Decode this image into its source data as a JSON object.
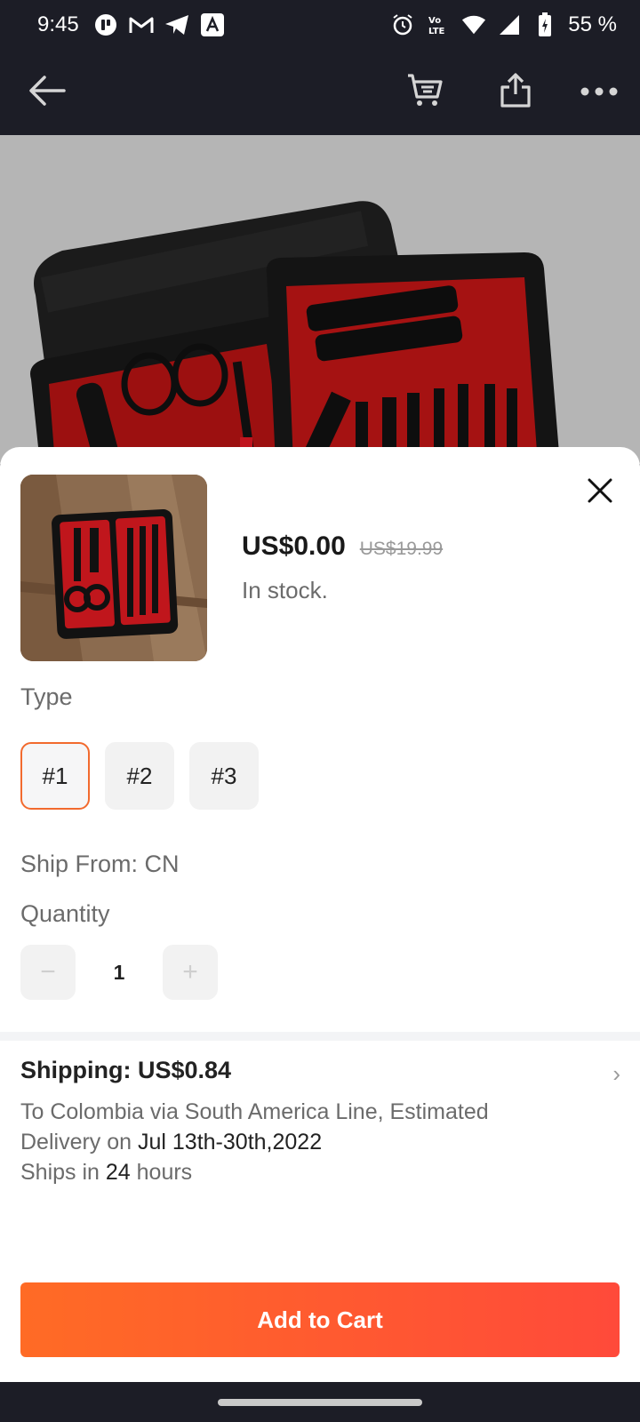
{
  "status_bar": {
    "time": "9:45",
    "battery": "55 %",
    "icons_left": [
      "app-icon",
      "gmail-icon",
      "telegram-icon",
      "app-store-icon"
    ],
    "icons_right": [
      "alarm-icon",
      "volte-icon",
      "wifi-icon",
      "signal-icon",
      "battery-icon"
    ]
  },
  "app_bar": {
    "icons": [
      "back-arrow-icon",
      "cart-icon",
      "share-icon",
      "more-icon"
    ]
  },
  "product": {
    "price": "US$0.00",
    "original_price": "US$19.99",
    "stock": "In stock."
  },
  "type": {
    "label": "Type",
    "options": [
      "#1",
      "#2",
      "#3"
    ],
    "selected": "#1"
  },
  "ship_from": "Ship From: CN",
  "quantity": {
    "label": "Quantity",
    "value": "1",
    "minus": "−",
    "plus": "+"
  },
  "shipping": {
    "title": "Shipping: US$0.84",
    "line1": "To Colombia via South America Line, Estimated",
    "line2_prefix": "Delivery on ",
    "delivery_dates": "Jul 13th-30th,2022",
    "line3_prefix": "Ships in ",
    "ship_hours": "24",
    "line3_suffix": " hours",
    "chevron": "›"
  },
  "cta": {
    "label": "Add to Cart",
    "color_start": "#ff6b25",
    "color_end": "#ff4a3a"
  },
  "colors": {
    "accent": "#f26a2e",
    "dark_bar": "#1c1d26"
  }
}
